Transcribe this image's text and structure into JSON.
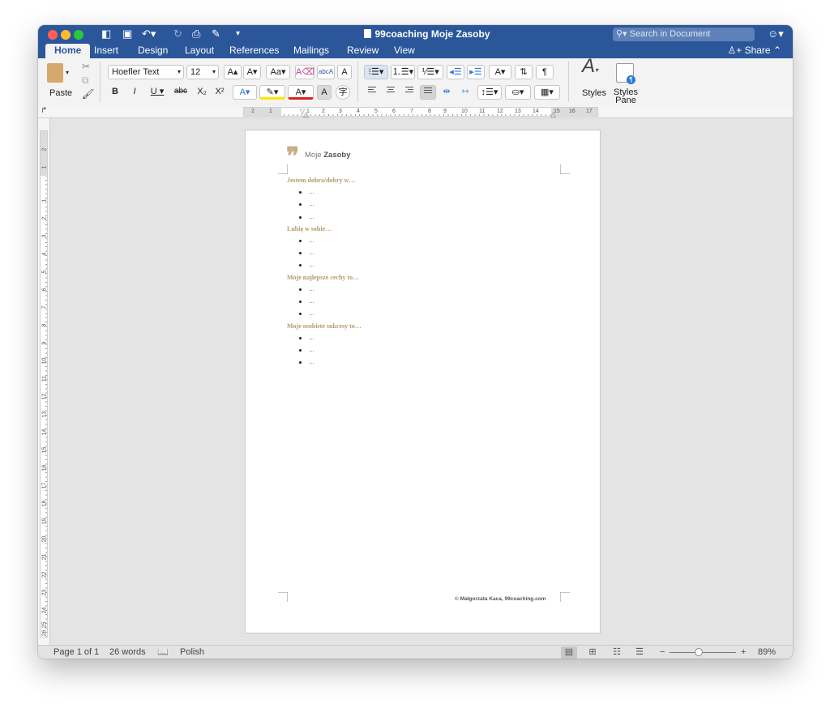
{
  "window": {
    "title": "99coaching Moje Zasoby",
    "search_placeholder": "Search in Document",
    "share_label": "Share"
  },
  "tabs": [
    "Home",
    "Insert",
    "Design",
    "Layout",
    "References",
    "Mailings",
    "Review",
    "View"
  ],
  "ribbon": {
    "paste_label": "Paste",
    "font_name": "Hoefler Text",
    "font_size": "12",
    "styles_label": "Styles",
    "styles_pane_label": "Styles Pane"
  },
  "ruler": {
    "h_numbers": [
      "2",
      "1",
      "1",
      "2",
      "3",
      "4",
      "5",
      "6",
      "7",
      "8",
      "9",
      "10",
      "11",
      "12",
      "13",
      "14",
      "15",
      "16",
      "17",
      "18"
    ],
    "v_numbers": [
      "2",
      "1",
      "1",
      "2",
      "3",
      "4",
      "5",
      "6",
      "7",
      "8",
      "9",
      "10",
      "11",
      "12",
      "13",
      "14",
      "15",
      "16",
      "17",
      "18",
      "19",
      "20",
      "21",
      "22",
      "23",
      "24",
      "25",
      "26"
    ]
  },
  "document": {
    "header_light": "Moje",
    "header_bold": "Zasoby",
    "sections": [
      {
        "heading": "Jestem dobra/dobry w…",
        "items": [
          "…",
          "…",
          "…"
        ]
      },
      {
        "heading": "Lubię w sobie…",
        "items": [
          "…",
          "…",
          "…"
        ]
      },
      {
        "heading": "Moje najlepsze cechy to…",
        "items": [
          "…",
          "…",
          "…"
        ]
      },
      {
        "heading": "Moje osobiste sukcesy to…",
        "items": [
          "…",
          "…",
          "…"
        ]
      }
    ],
    "footer": "© Małgorzata Kaca, 99coaching.com"
  },
  "status": {
    "page": "Page 1 of 1",
    "words": "26 words",
    "language": "Polish",
    "zoom": "89%"
  },
  "colors": {
    "title_bar": "#2b579a",
    "heading_accent": "#b5996c"
  }
}
